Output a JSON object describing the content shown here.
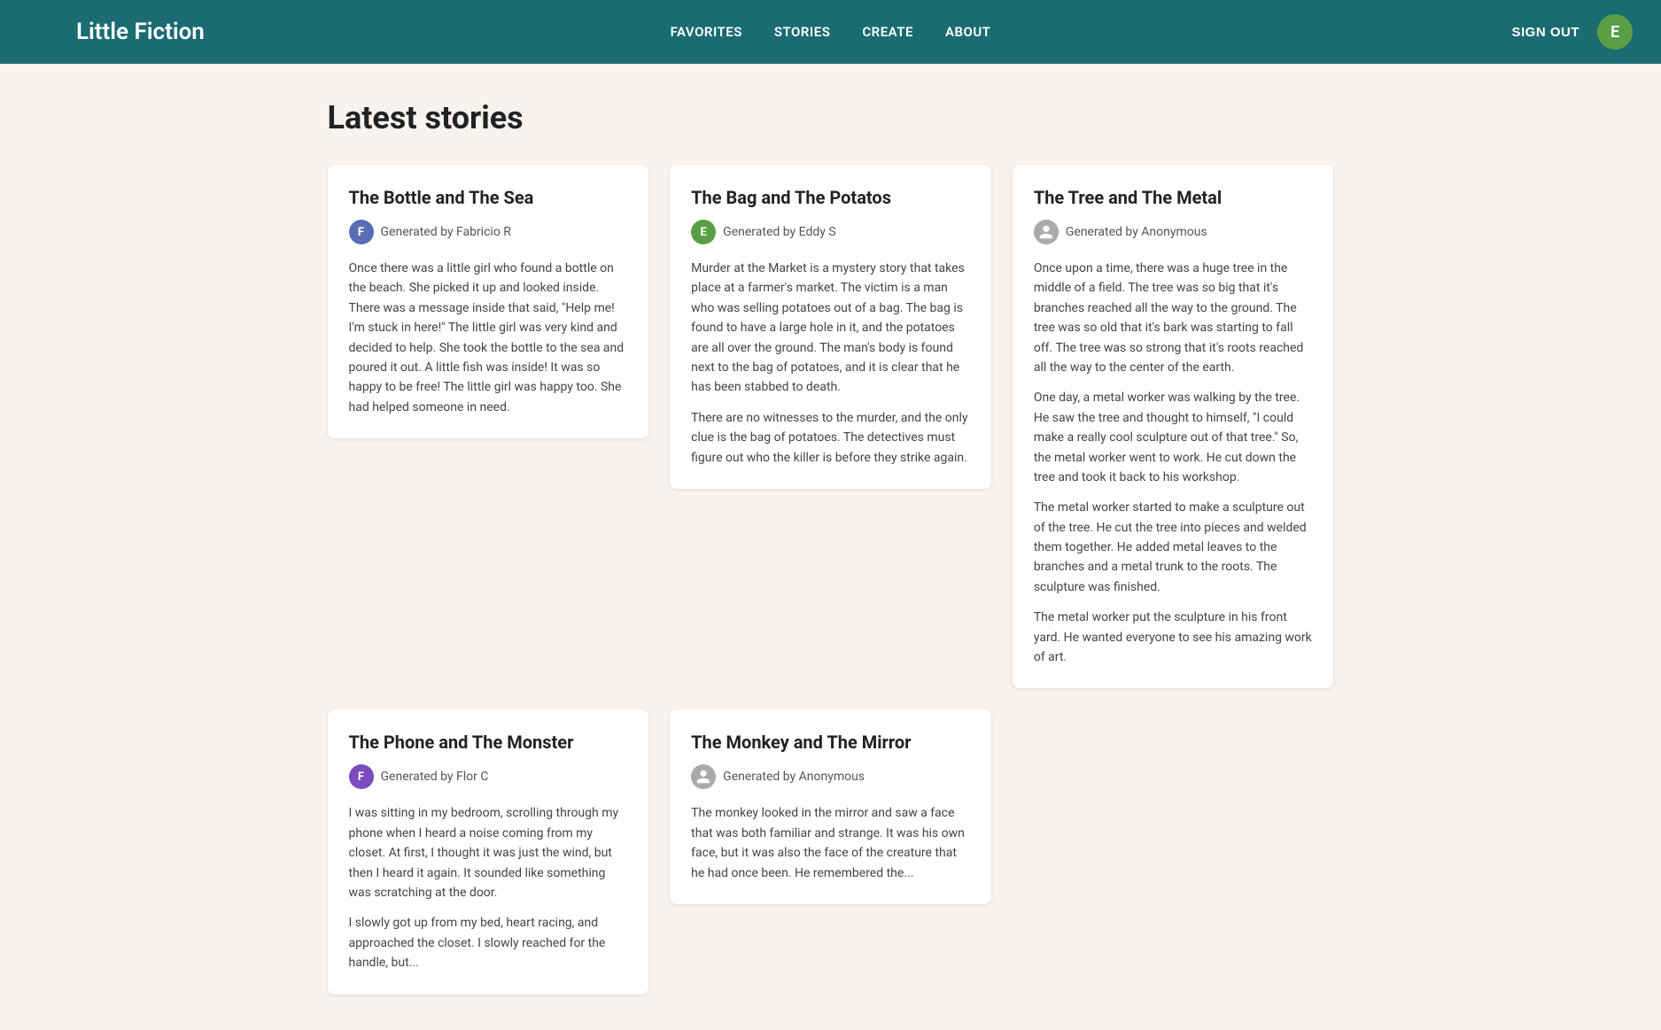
{
  "nav": {
    "logo_text": "Little Fiction",
    "links": [
      "FAVORITES",
      "STORIES",
      "CREATE",
      "ABOUT"
    ],
    "sign_out_label": "SIGN OUT",
    "user_initial": "E"
  },
  "page": {
    "title": "Latest stories"
  },
  "stories": [
    {
      "id": "bottle-sea",
      "title": "The Bottle and The Sea",
      "author": "Generated by Fabricio R",
      "author_initial": "F",
      "author_color": "#5b6eb5",
      "anon": false,
      "paragraphs": [
        "Once there was a little girl who found a bottle on the beach. She picked it up and looked inside. There was a message inside that said, \"Help me! I'm stuck in here!\" The little girl was very kind and decided to help. She took the bottle to the sea and poured it out. A little fish was inside! It was so happy to be free! The little girl was happy too. She had helped someone in need."
      ]
    },
    {
      "id": "bag-potatos",
      "title": "The Bag and The Potatos",
      "author": "Generated by Eddy S",
      "author_initial": "E",
      "author_color": "#5a9e46",
      "anon": false,
      "paragraphs": [
        "Murder at the Market is a mystery story that takes place at a farmer's market. The victim is a man who was selling potatoes out of a bag. The bag is found to have a large hole in it, and the potatoes are all over the ground. The man's body is found next to the bag of potatoes, and it is clear that he has been stabbed to death.",
        "There are no witnesses to the murder, and the only clue is the bag of potatoes. The detectives must figure out who the killer is before they strike again."
      ]
    },
    {
      "id": "tree-metal",
      "title": "The Tree and The Metal",
      "author": "Generated by Anonymous",
      "author_initial": "",
      "author_color": "#aaa",
      "anon": true,
      "paragraphs": [
        "Once upon a time, there was a huge tree in the middle of a field. The tree was so big that it's branches reached all the way to the ground. The tree was so old that it's bark was starting to fall off. The tree was so strong that it's roots reached all the way to the center of the earth.",
        "One day, a metal worker was walking by the tree. He saw the tree and thought to himself, \"I could make a really cool sculpture out of that tree.\" So, the metal worker went to work. He cut down the tree and took it back to his workshop.",
        "The metal worker started to make a sculpture out of the tree. He cut the tree into pieces and welded them together. He added metal leaves to the branches and a metal trunk to the roots. The sculpture was finished.",
        "The metal worker put the sculpture in his front yard. He wanted everyone to see his amazing work of art."
      ]
    },
    {
      "id": "phone-monster",
      "title": "The Phone and The Monster",
      "author": "Generated by Flor C",
      "author_initial": "F",
      "author_color": "#7b4bbf",
      "anon": false,
      "paragraphs": [
        "I was sitting in my bedroom, scrolling through my phone when I heard a noise coming from my closet. At first, I thought it was just the wind, but then I heard it again. It sounded like something was scratching at the door.",
        "I slowly got up from my bed, heart racing, and approached the closet. I slowly reached for the handle, but..."
      ]
    },
    {
      "id": "monkey-mirror",
      "title": "The Monkey and The Mirror",
      "author": "Generated by Anonymous",
      "author_initial": "",
      "author_color": "#aaa",
      "anon": true,
      "paragraphs": [
        "The monkey looked in the mirror and saw a face that was both familiar and strange. It was his own face, but it was also the face of the creature that he had once been. He remembered the..."
      ]
    }
  ]
}
